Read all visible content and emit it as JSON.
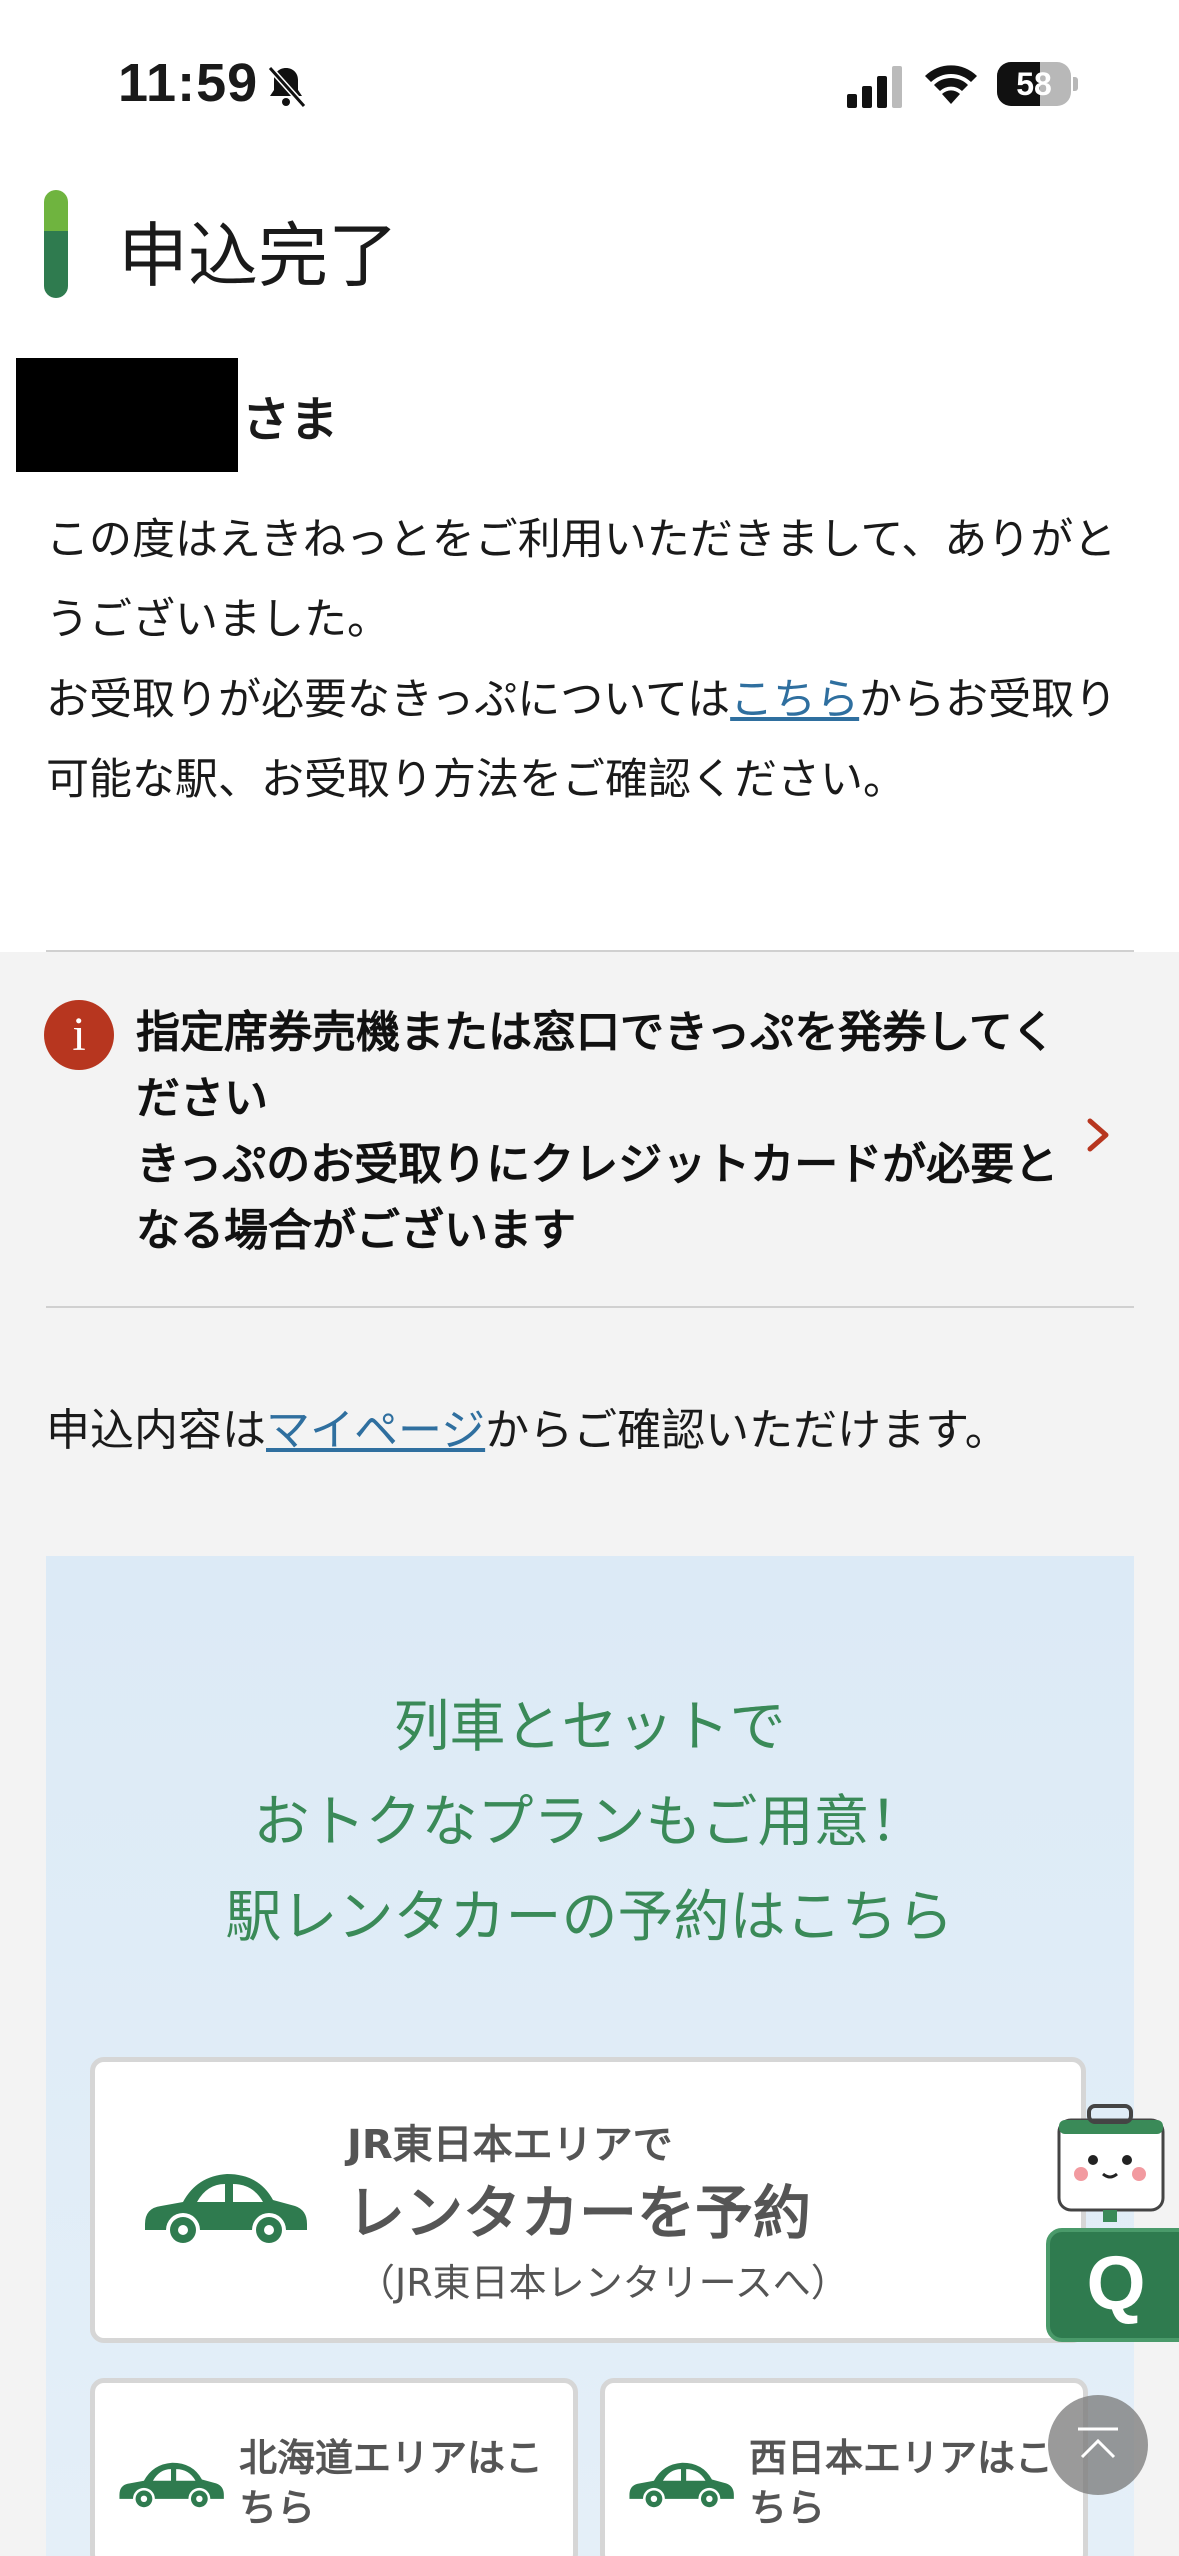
{
  "status_bar": {
    "time": "11:59",
    "battery": "58",
    "battery_level": 0.58,
    "icons": [
      "bell-slash-icon",
      "cellular-signal-icon",
      "wifi-icon",
      "battery-icon"
    ]
  },
  "page": {
    "title": "申込完了",
    "name_suffix": "さま",
    "intro_line1": "この度はえきねっとをご利用いただきまして、ありがとうございました。",
    "intro_line2_before": "お受取りが必要なきっぷについては",
    "intro_link": "こちら",
    "intro_line2_after": "からお受取り可能な駅、お受取り方法をご確認ください。"
  },
  "notice": {
    "line1": "指定席券売機または窓口できっぷを発券してください",
    "line2": "きっぷのお受取りにクレジットカードが必要となる場合がございます",
    "icon": "info-icon",
    "accent": "#b7361f"
  },
  "mypage": {
    "before": "申込内容は",
    "link": "マイページ",
    "after": "からご確認いただけます。"
  },
  "promo": {
    "line1": "列車とセットで",
    "line2": "おトクなプランもご用意！",
    "line3": "駅レンタカーの予約はこちら",
    "main_button": {
      "small": "JR東日本エリアで",
      "big": "レンタカーを予約",
      "note": "（JR東日本レンタリースへ）"
    },
    "sub_buttons": [
      {
        "label": "北海道エリアはこちら"
      },
      {
        "label": "西日本エリアはこちら"
      }
    ],
    "accent": "#2f7b4f"
  },
  "floating": {
    "q_label": "Q"
  }
}
